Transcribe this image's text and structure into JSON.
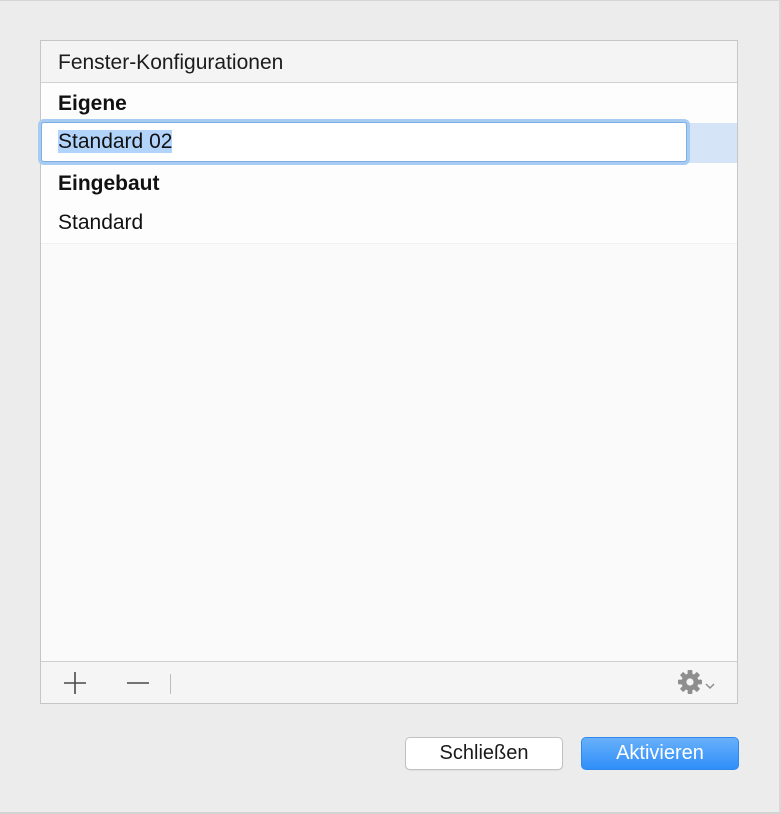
{
  "panel": {
    "header": "Fenster-Konfigurationen",
    "groups": [
      {
        "title": "Eigene",
        "items": [
          {
            "label": "Standard 02",
            "selected": true,
            "editing": true
          }
        ]
      },
      {
        "title": "Eingebaut",
        "items": [
          {
            "label": "Standard",
            "selected": false,
            "editing": false
          }
        ]
      }
    ]
  },
  "toolbar": {
    "add_icon": "plus-icon",
    "remove_icon": "minus-icon",
    "actions_icon": "gear-icon"
  },
  "buttons": {
    "close_label": "Schließen",
    "activate_label": "Aktivieren"
  },
  "colors": {
    "accent": "#2e8ef8",
    "selection": "#d5e5f7",
    "focus_ring": "#a8cbf2"
  }
}
